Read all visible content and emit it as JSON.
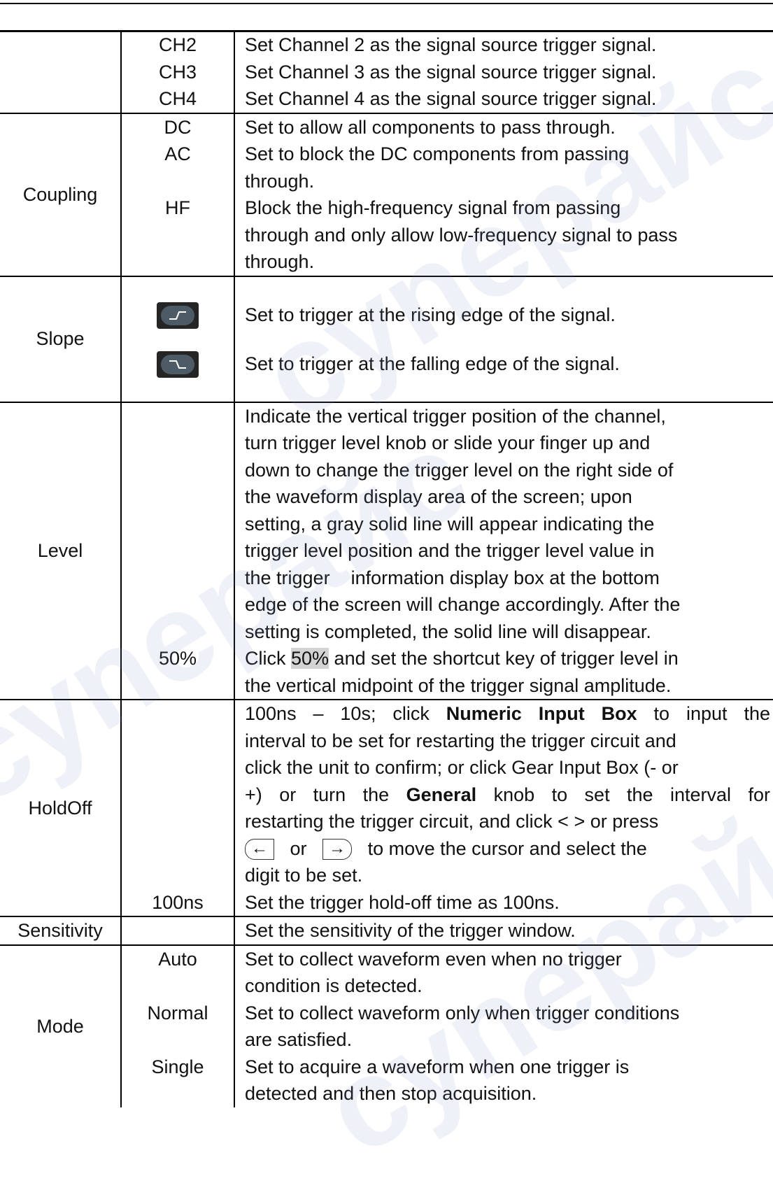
{
  "rows": {
    "source": {
      "items": [
        {
          "option": "CH2",
          "desc": "Set Channel 2 as the signal source trigger signal."
        },
        {
          "option": "CH3",
          "desc": "Set Channel 3 as the signal source trigger signal."
        },
        {
          "option": "CH4",
          "desc": "Set Channel 4 as the signal source trigger signal."
        }
      ]
    },
    "coupling": {
      "label": "Coupling",
      "dc": {
        "option": "DC",
        "desc": "Set to allow all components to pass through."
      },
      "ac": {
        "option": "AC",
        "desc1": "Set to block the DC components from passing",
        "desc2": "through."
      },
      "hf": {
        "option": "HF",
        "desc1": "Block the high-frequency signal from passing",
        "desc2": "through and only allow low-frequency signal to pass",
        "desc3": "through."
      }
    },
    "slope": {
      "label": "Slope",
      "rising_icon": "rising-edge-icon",
      "falling_icon": "falling-edge-icon",
      "rising_desc": "Set to trigger at the rising edge of the signal.",
      "falling_desc": "Set to trigger at the falling edge of the signal."
    },
    "level": {
      "label": "Level",
      "lines": [
        "Indicate the vertical trigger position of the channel,",
        "turn trigger level knob or slide your finger up and",
        "down to change the trigger level on the right side of",
        "the waveform display area of the screen; upon",
        "setting, a gray solid line will appear indicating the",
        "trigger level position and the trigger level value in",
        "the trigger    information display box at the bottom",
        "edge of the screen will change accordingly. After the",
        "setting is completed, the solid line will disappear."
      ],
      "fifty": {
        "option": "50%",
        "pre": "Click ",
        "highlight": "50%",
        "post": " and set the shortcut key of trigger level in",
        "line2": "the vertical midpoint of the trigger signal amplitude."
      }
    },
    "holdoff": {
      "label": "HoldOff",
      "l1a": "100ns – 10s; click ",
      "l1b": "Numeric Input Box",
      "l1c": " to input the",
      "l2": "interval to be set for restarting the trigger circuit and",
      "l3": "click the unit to confirm; or click Gear Input Box (- or",
      "l4a": "+) or turn the ",
      "l4b": "General",
      "l4c": " knob to set the interval for",
      "l5": "restarting the trigger circuit, and click < > or press",
      "l6_or": "or",
      "l6_rest": "to move the cursor and select the",
      "left_key": "←",
      "right_key": "→",
      "l7": "digit to be set.",
      "option_100ns": "100ns",
      "desc_100ns": "Set the trigger hold-off time as 100ns."
    },
    "sensitivity": {
      "label": "Sensitivity",
      "desc": "Set the sensitivity of the trigger window."
    },
    "mode": {
      "label": "Mode",
      "auto": {
        "option": "Auto",
        "desc1": "Set to collect waveform even when no trigger",
        "desc2": "condition is detected."
      },
      "normal": {
        "option": "Normal",
        "desc1": "Set to collect waveform only when trigger conditions",
        "desc2": "are satisfied."
      },
      "single": {
        "option": "Single",
        "desc1": "Set to acquire a waveform when one trigger is",
        "desc2": "detected and then stop acquisition."
      }
    }
  },
  "watermark": "cynepaйc"
}
